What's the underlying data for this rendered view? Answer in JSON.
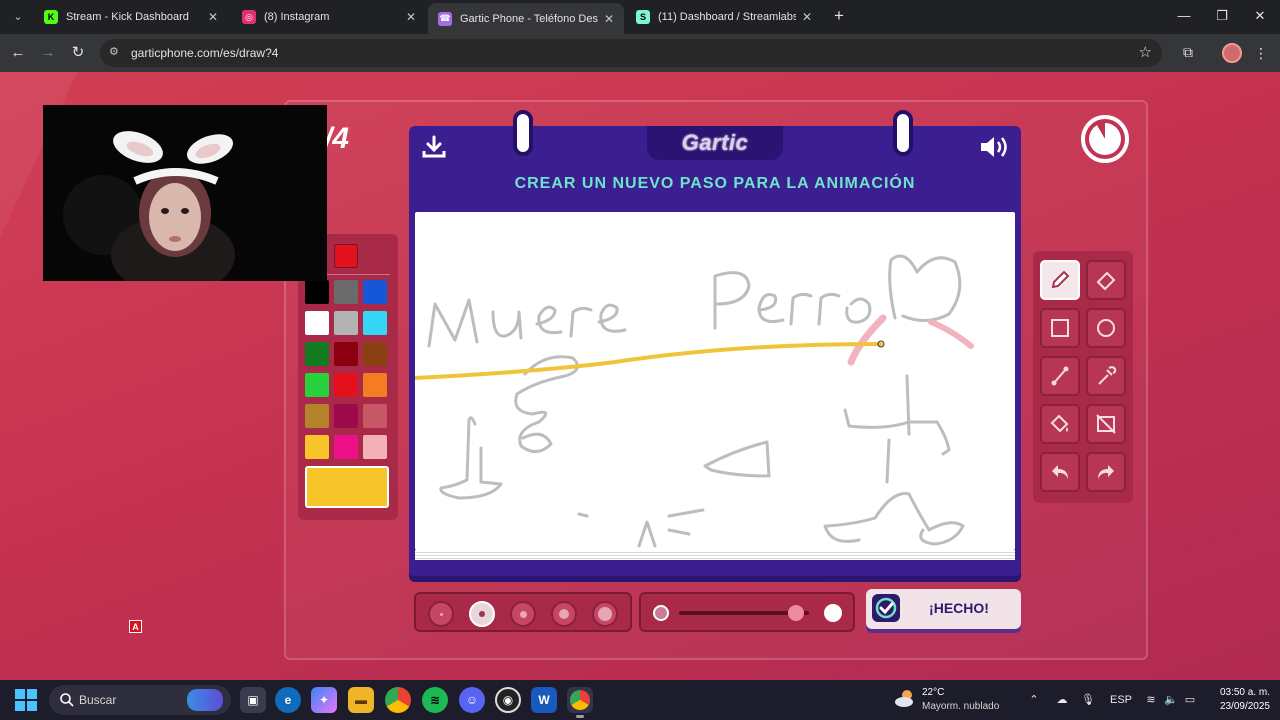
{
  "browser": {
    "tabs": [
      {
        "title": "Stream - Kick Dashboard",
        "favicon_color": "#53fc18",
        "favicon_text": "K"
      },
      {
        "title": "(8) Instagram",
        "favicon_color": "#e1306c",
        "favicon_text": "◎"
      },
      {
        "title": "Gartic Phone - Teléfono Descon",
        "favicon_color": "#a56de2",
        "favicon_text": "☎"
      },
      {
        "title": "(11) Dashboard / Streamlabs",
        "favicon_color": "#80f5d2",
        "favicon_text": "S"
      }
    ],
    "url": "garticphone.com/es/draw?4"
  },
  "game": {
    "step_counter": "/4",
    "logo": "Gartic",
    "heading": "CREAR UN NUEVO PASO PARA LA ANIMACIÓN",
    "done_label": "¡HECHO!",
    "canvas_text": "Muere Perro",
    "palette": {
      "top_swatch": "#e4101c",
      "colors": [
        [
          "#000000",
          "#6b6b6b",
          "#1557d6"
        ],
        [
          "#ffffff",
          "#b3b3b3",
          "#33d6f5"
        ],
        [
          "#137b1f",
          "#8a0010",
          "#8a4010"
        ],
        [
          "#27d13c",
          "#e4101c",
          "#f57c20"
        ],
        [
          "#b5832a",
          "#9b0b4c",
          "#c9576a"
        ],
        [
          "#f7c52a",
          "#ee1088",
          "#f3b0b6"
        ]
      ],
      "current_color": "#f7c52a"
    },
    "tools": [
      "pencil",
      "eraser",
      "rectangle",
      "ellipse",
      "line",
      "eyedropper",
      "fill",
      "clear",
      "undo",
      "redo"
    ],
    "selected_tool": "pencil",
    "brush_sizes": 5,
    "selected_brush_size": 2,
    "opacity_level": 0.9
  },
  "taskbar": {
    "search_placeholder": "Buscar",
    "weather_temp": "22°C",
    "weather_desc": "Mayorm. nublado",
    "lang": "ESP",
    "time": "03:50 a. m.",
    "date": "23/09/2025"
  },
  "overlay_badge": "A"
}
